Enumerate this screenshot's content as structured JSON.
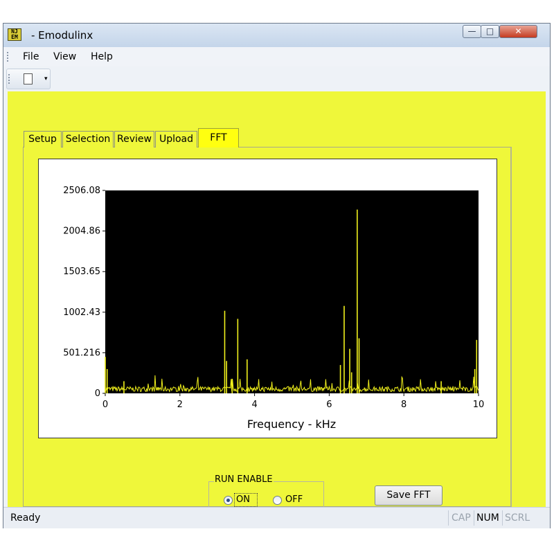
{
  "window": {
    "title": "- Emodulinx",
    "icon": "app-logo-icon"
  },
  "title_buttons": {
    "minimize": "—",
    "maximize": "□",
    "close": "✕"
  },
  "menu": {
    "items": [
      "File",
      "View",
      "Help"
    ]
  },
  "toolbar": {
    "new_icon": "new-document-icon",
    "dropdown_glyph": "▾"
  },
  "tabs": [
    {
      "label": "Setup",
      "active": false
    },
    {
      "label": "Selection",
      "active": false
    },
    {
      "label": "Review",
      "active": false
    },
    {
      "label": "Upload",
      "active": false
    },
    {
      "label": "FFT",
      "active": true
    }
  ],
  "colors": {
    "panel": "#eff73a",
    "active_tab": "#ffff10",
    "plot_background": "#000000",
    "spectrum": "#f2f21c"
  },
  "chart_data": {
    "type": "line",
    "title": "",
    "xlabel": "Frequency - kHz",
    "ylabel": "",
    "xlim": [
      0,
      10
    ],
    "ylim": [
      0,
      2506.08
    ],
    "x_ticks": [
      0,
      2,
      4,
      6,
      8,
      10
    ],
    "y_ticks": [
      "0",
      "501.216",
      "1002.43",
      "1503.65",
      "2004.86",
      "2506.08"
    ],
    "grid": false,
    "background": "#000000",
    "series_color": "#f2f21c",
    "peaks": [
      {
        "x": 0.0,
        "y": 450
      },
      {
        "x": 0.05,
        "y": 300
      },
      {
        "x": 0.5,
        "y": 150
      },
      {
        "x": 3.2,
        "y": 1020
      },
      {
        "x": 3.25,
        "y": 400
      },
      {
        "x": 3.55,
        "y": 920
      },
      {
        "x": 3.8,
        "y": 420
      },
      {
        "x": 3.4,
        "y": 180
      },
      {
        "x": 6.4,
        "y": 1080
      },
      {
        "x": 6.3,
        "y": 350
      },
      {
        "x": 6.55,
        "y": 550
      },
      {
        "x": 6.75,
        "y": 2270
      },
      {
        "x": 6.8,
        "y": 680
      },
      {
        "x": 6.6,
        "y": 260
      },
      {
        "x": 9.0,
        "y": 150
      },
      {
        "x": 9.95,
        "y": 660
      },
      {
        "x": 9.9,
        "y": 300
      }
    ],
    "noise_floor": 70
  },
  "run_enable": {
    "legend": "RUN ENABLE",
    "options": [
      {
        "label": "ON",
        "selected": true
      },
      {
        "label": "OFF",
        "selected": false
      }
    ]
  },
  "save_button": {
    "label": "Save FFT"
  },
  "status": {
    "text": "Ready",
    "indicators": [
      {
        "label": "CAP",
        "active": false
      },
      {
        "label": "NUM",
        "active": true
      },
      {
        "label": "SCRL",
        "active": false
      }
    ]
  }
}
